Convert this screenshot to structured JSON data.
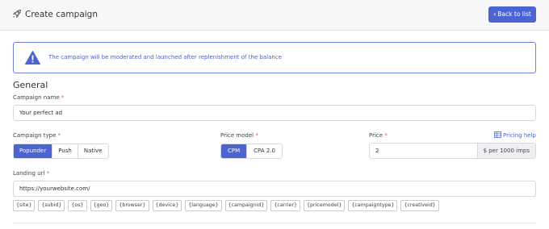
{
  "header": {
    "title": "Create campaign",
    "back_label": "Back to list",
    "rocket_icon": "rocket-icon",
    "chevron_icon": "chevron-left-icon"
  },
  "alert": {
    "message": "The campaign will be moderated and launched after replenishment of the balance",
    "icon": "warning-icon",
    "color": "#4c63d2"
  },
  "general": {
    "title": "General",
    "campaign_name_label": "Campaign name",
    "campaign_name_value": "Your perfect ad",
    "campaign_type_label": "Campaign type",
    "campaign_types": [
      "Popunder",
      "Push",
      "Native"
    ],
    "campaign_type_selected": "Popunder",
    "price_model_label": "Price model",
    "price_models": [
      "CPM",
      "CPA 2.0"
    ],
    "price_model_selected": "CPM",
    "price_label": "Price",
    "price_value": "2",
    "price_suffix": "$ per 1000 imps",
    "pricing_help": "Pricing help",
    "landing_url_label": "Landing url",
    "landing_url_value": "https://yourwebsite.com/",
    "required_mark": "*"
  },
  "macros": [
    "{site}",
    "{subid}",
    "{os}",
    "{geo}",
    "{browser}",
    "{device}",
    "{language}",
    "{campaignid}",
    "{carrier}",
    "{pricemodel}",
    "{campaigntype}",
    "{creativeid}"
  ],
  "colors": {
    "accent": "#4c63d2",
    "required": "#e05555"
  }
}
